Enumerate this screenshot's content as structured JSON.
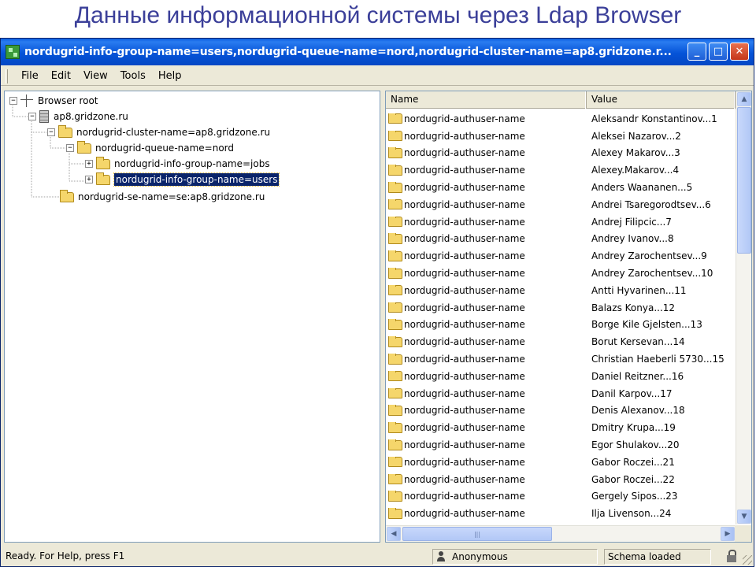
{
  "slide": {
    "title": "Данные информационной системы через Ldap Browser"
  },
  "window": {
    "title": "nordugrid-info-group-name=users,nordugrid-queue-name=nord,nordugrid-cluster-name=ap8.gridzone.r..."
  },
  "menu": {
    "items": [
      {
        "label": "File"
      },
      {
        "label": "Edit"
      },
      {
        "label": "View"
      },
      {
        "label": "Tools"
      },
      {
        "label": "Help"
      }
    ]
  },
  "tree": {
    "nodes": [
      {
        "label": "Browser root",
        "expander": "−",
        "icon": "root-icon"
      },
      {
        "label": "ap8.gridzone.ru",
        "expander": "−",
        "icon": "server-icon"
      },
      {
        "label": "nordugrid-cluster-name=ap8.gridzone.ru",
        "expander": "−",
        "icon": "folder-icon"
      },
      {
        "label": "nordugrid-queue-name=nord",
        "expander": "−",
        "icon": "folder-icon"
      },
      {
        "label": "nordugrid-info-group-name=jobs",
        "expander": "+",
        "icon": "folder-icon"
      },
      {
        "label": "nordugrid-info-group-name=users",
        "expander": "+",
        "icon": "folder-icon",
        "selected": true
      },
      {
        "label": "nordugrid-se-name=se:ap8.gridzone.ru",
        "expander": "",
        "icon": "folder-icon"
      }
    ]
  },
  "list": {
    "columns": {
      "name": "Name",
      "value": "Value"
    },
    "rows": [
      {
        "name": "nordugrid-authuser-name",
        "value": "Aleksandr Konstantinov...1"
      },
      {
        "name": "nordugrid-authuser-name",
        "value": "Aleksei Nazarov...2"
      },
      {
        "name": "nordugrid-authuser-name",
        "value": "Alexey Makarov...3"
      },
      {
        "name": "nordugrid-authuser-name",
        "value": "Alexey.Makarov...4"
      },
      {
        "name": "nordugrid-authuser-name",
        "value": "Anders Waananen...5"
      },
      {
        "name": "nordugrid-authuser-name",
        "value": "Andrei Tsaregorodtsev...6"
      },
      {
        "name": "nordugrid-authuser-name",
        "value": "Andrej Filipcic...7"
      },
      {
        "name": "nordugrid-authuser-name",
        "value": "Andrey Ivanov...8"
      },
      {
        "name": "nordugrid-authuser-name",
        "value": "Andrey Zarochentsev...9"
      },
      {
        "name": "nordugrid-authuser-name",
        "value": "Andrey Zarochentsev...10"
      },
      {
        "name": "nordugrid-authuser-name",
        "value": "Antti Hyvarinen...11"
      },
      {
        "name": "nordugrid-authuser-name",
        "value": "Balazs Konya...12"
      },
      {
        "name": "nordugrid-authuser-name",
        "value": "Borge Kile Gjelsten...13"
      },
      {
        "name": "nordugrid-authuser-name",
        "value": "Borut Kersevan...14"
      },
      {
        "name": "nordugrid-authuser-name",
        "value": "Christian Haeberli 5730...15"
      },
      {
        "name": "nordugrid-authuser-name",
        "value": "Daniel Reitzner...16"
      },
      {
        "name": "nordugrid-authuser-name",
        "value": "Danil Karpov...17"
      },
      {
        "name": "nordugrid-authuser-name",
        "value": "Denis Alexanov...18"
      },
      {
        "name": "nordugrid-authuser-name",
        "value": "Dmitry Krupa...19"
      },
      {
        "name": "nordugrid-authuser-name",
        "value": "Egor Shulakov...20"
      },
      {
        "name": "nordugrid-authuser-name",
        "value": "Gabor Roczei...21"
      },
      {
        "name": "nordugrid-authuser-name",
        "value": "Gabor Roczei...22"
      },
      {
        "name": "nordugrid-authuser-name",
        "value": "Gergely Sipos...23"
      },
      {
        "name": "nordugrid-authuser-name",
        "value": "Ilja Livenson...24"
      }
    ]
  },
  "status": {
    "message": "Ready. For Help, press F1",
    "user": "Anonymous",
    "schema": "Schema loaded"
  },
  "colors": {
    "slide_title": "#3b3f99",
    "titlebar": "#0553d8",
    "selection": "#0a246a",
    "folder": "#f5d66b"
  }
}
